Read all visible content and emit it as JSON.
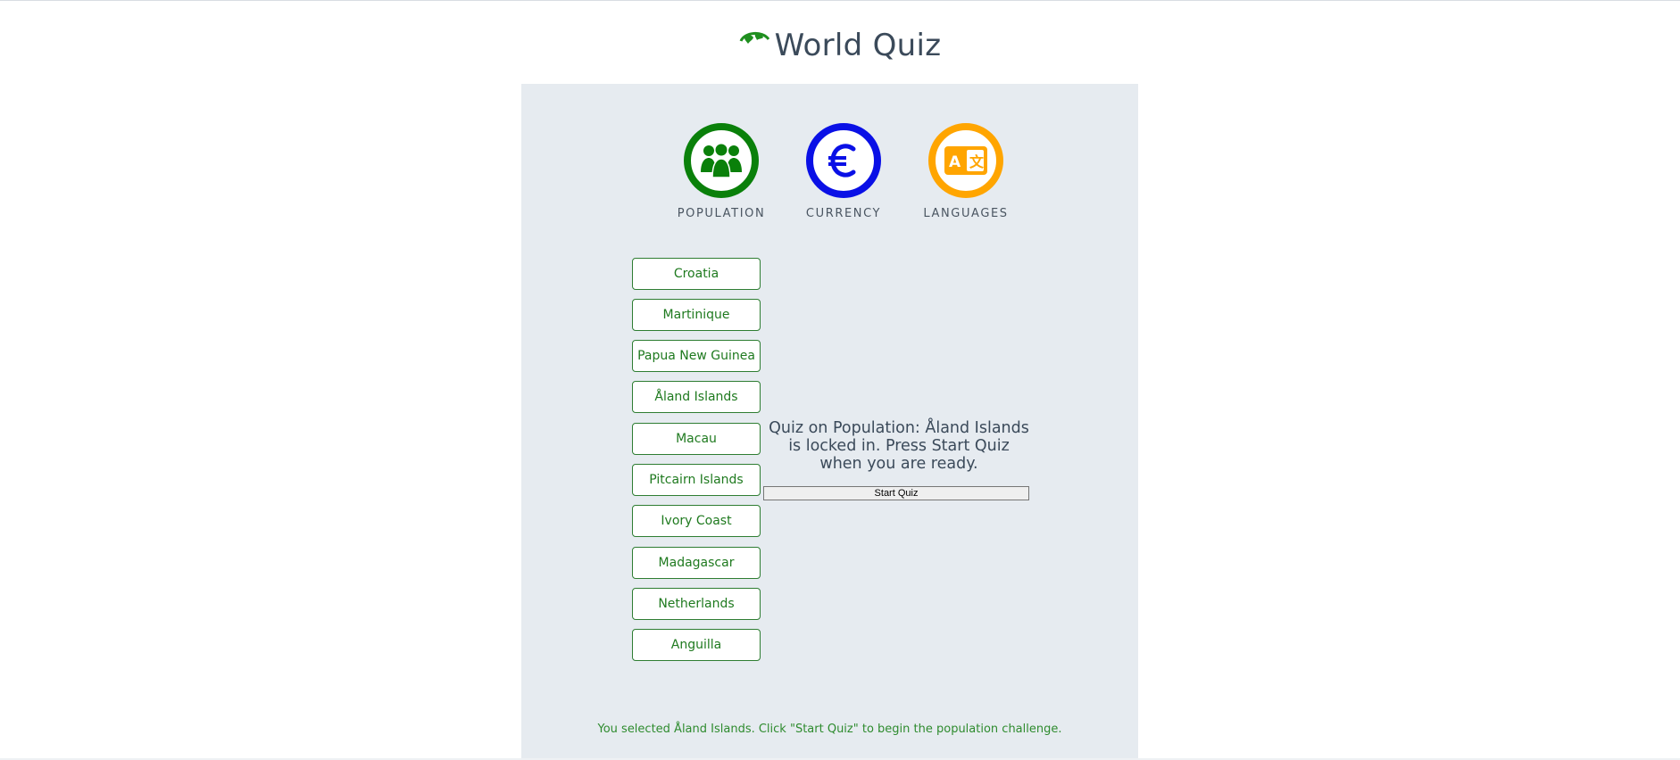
{
  "app": {
    "title": "World Quiz"
  },
  "categories": [
    {
      "label": "POPULATION",
      "icon": "people-icon",
      "color": "#0a800a"
    },
    {
      "label": "CURRENCY",
      "icon": "euro-icon",
      "color": "#0a10e6"
    },
    {
      "label": "LANGUAGES",
      "icon": "translate-icon",
      "color": "#ffa500"
    }
  ],
  "countries": [
    "Croatia",
    "Martinique",
    "Papua New Guinea",
    "Åland Islands",
    "Macau",
    "Pitcairn Islands",
    "Ivory Coast",
    "Madagascar",
    "Netherlands",
    "Anguilla"
  ],
  "quiz": {
    "message": "Quiz on Population: Åland Islands is locked in. Press Start Quiz when you are ready.",
    "start_label": "Start Quiz"
  },
  "status": {
    "text": "You selected Åland Islands. Click \"Start Quiz\" to begin the population challenge."
  }
}
